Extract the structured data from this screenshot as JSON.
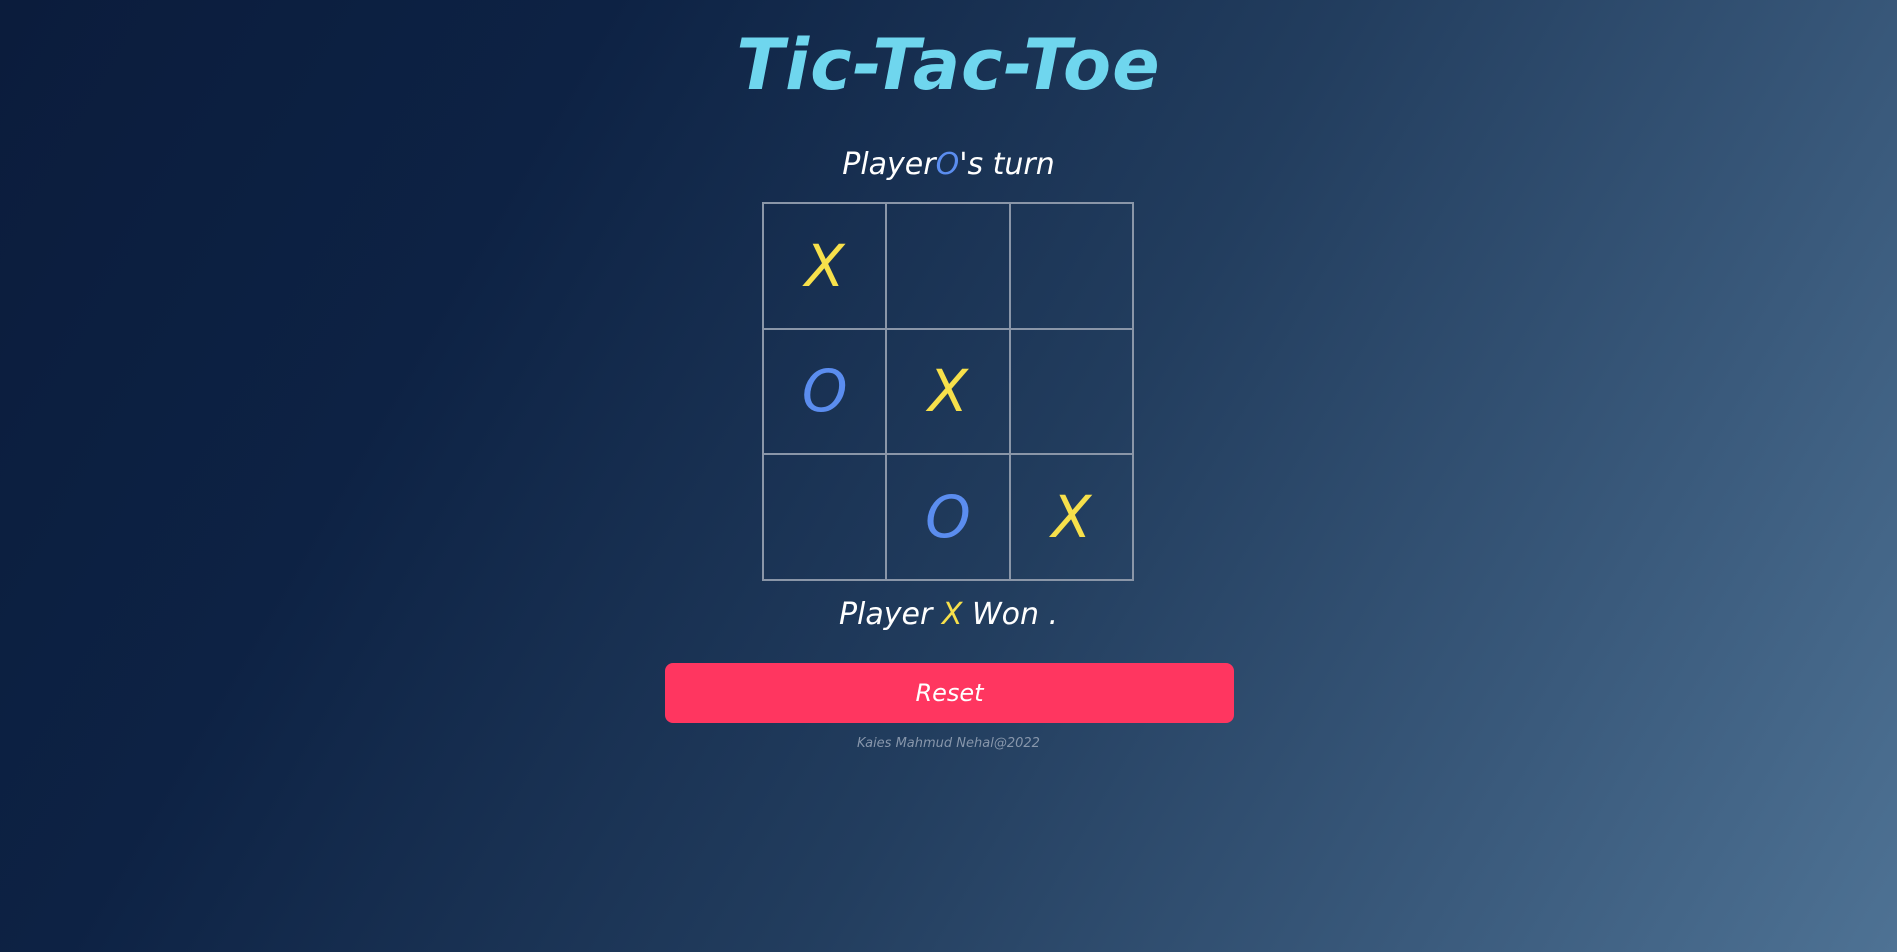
{
  "title": "Tic-Tac-Toe",
  "turn": {
    "prefix": "Player",
    "mark": "O",
    "suffix": "'s turn"
  },
  "board": {
    "cells": [
      "X",
      "",
      "",
      "O",
      "X",
      "",
      "",
      "O",
      "X"
    ]
  },
  "result": {
    "prefix": "Player ",
    "mark": "X",
    "suffix": " Won ."
  },
  "reset_label": "Reset",
  "footer": "Kaies Mahmud Nehal@2022",
  "colors": {
    "title": "#6fd6ee",
    "x": "#f7e04b",
    "o": "#5b8def",
    "reset": "#ff3660"
  }
}
